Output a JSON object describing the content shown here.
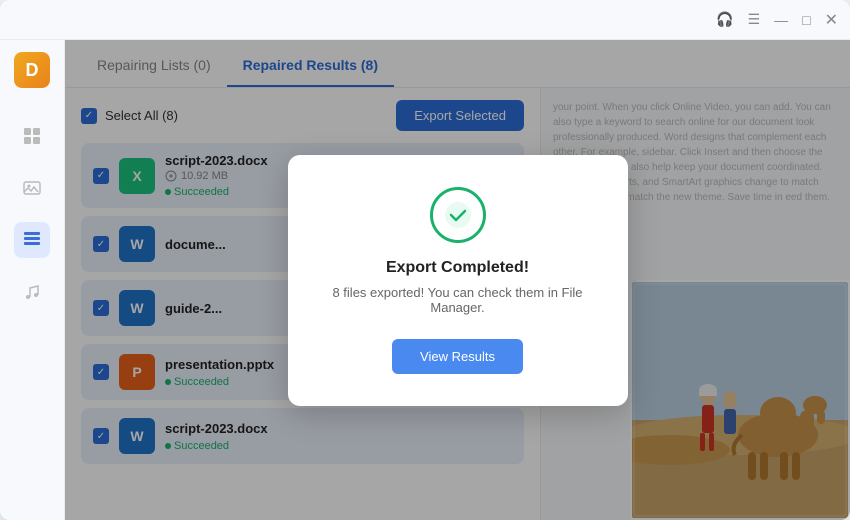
{
  "titlebar": {
    "icons": [
      "headphones",
      "menu",
      "minimize",
      "maximize",
      "close"
    ]
  },
  "sidebar": {
    "logo_letter": "D",
    "items": [
      {
        "name": "grid",
        "icon": "⊞",
        "active": false
      },
      {
        "name": "image",
        "icon": "🖼",
        "active": false
      },
      {
        "name": "document",
        "icon": "≡",
        "active": true
      },
      {
        "name": "music",
        "icon": "♪",
        "active": false
      }
    ]
  },
  "tabs": [
    {
      "label": "Repairing Lists (0)",
      "active": false
    },
    {
      "label": "Repaired Results (8)",
      "active": true
    }
  ],
  "toolbar": {
    "select_all_label": "Select All (8)",
    "export_button_label": "Export Selected"
  },
  "files": [
    {
      "name": "script-2023.docx",
      "icon_type": "docx-x",
      "icon_letter": "X",
      "size": "10.92 MB",
      "status": "Succeeded",
      "selected": true,
      "show_size": true
    },
    {
      "name": "docume...",
      "icon_type": "docx",
      "icon_letter": "W",
      "size": "",
      "status": "",
      "selected": true,
      "show_size": false
    },
    {
      "name": "guide-2...",
      "icon_type": "docx",
      "icon_letter": "W",
      "size": "",
      "status": "",
      "selected": true,
      "show_size": false
    },
    {
      "name": "presentation.pptx",
      "icon_type": "pptx",
      "icon_letter": "P",
      "size": "",
      "status": "Succeeded",
      "selected": true,
      "show_size": false
    },
    {
      "name": "script-2023.docx",
      "icon_type": "docx",
      "icon_letter": "W",
      "size": "",
      "status": "Succeeded",
      "selected": true,
      "show_size": false
    }
  ],
  "preview_text": "your point. When you click Online Video, you can add. You can also type a keyword to search online for our document look professionally produced. Word designs that complement each other. For example, sidebar. Click Insert and then choose the elements you les also help keep your document coordinated. When tures, charts, and SmartArt graphics change to match dings change to match the new theme. Save time in eed them.",
  "modal": {
    "title": "Export Completed!",
    "message": "8 files exported! You can check them in File Manager.",
    "button_label": "View Results"
  }
}
